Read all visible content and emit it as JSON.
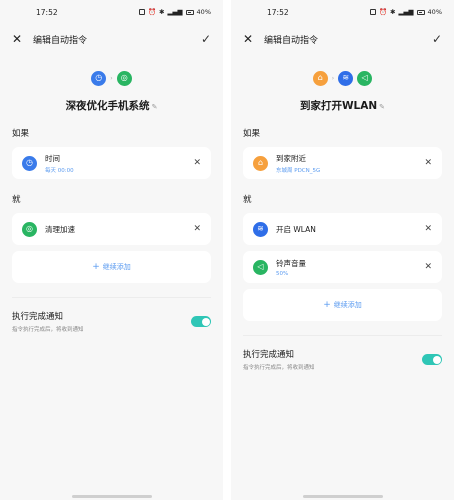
{
  "left": {
    "status": {
      "time": "17:52",
      "battery": "40%"
    },
    "topbar": {
      "title": "编辑自动指令"
    },
    "hero": {
      "name": "深夜优化手机系统"
    },
    "if_section": {
      "title": "如果"
    },
    "if_card": {
      "title": "时间",
      "sub": "每天 00:00"
    },
    "then_section": {
      "title": "就"
    },
    "then_cards": [
      {
        "title": "清理加速",
        "sub": ""
      }
    ],
    "add_label": "继续添加",
    "notify": {
      "title": "执行完成通知",
      "sub": "指令执行完成后，将收到通知",
      "enabled": true
    }
  },
  "right": {
    "status": {
      "time": "17:52",
      "battery": "40%"
    },
    "topbar": {
      "title": "编辑自动指令"
    },
    "hero": {
      "name": "到家打开WLAN"
    },
    "if_section": {
      "title": "如果"
    },
    "if_card": {
      "title": "到家附近",
      "sub": "东城周 PDCN_5G"
    },
    "then_section": {
      "title": "就"
    },
    "then_cards": [
      {
        "title": "开启 WLAN",
        "sub": ""
      },
      {
        "title": "铃声音量",
        "sub": "50%"
      }
    ],
    "add_label": "继续添加",
    "notify": {
      "title": "执行完成通知",
      "sub": "指令执行完成后，将收到通知",
      "enabled": true
    }
  },
  "icons": {
    "clock": "clock-icon",
    "clean": "clean-icon",
    "home": "home-icon",
    "wifi": "wifi-icon",
    "volume": "volume-icon"
  },
  "colors": {
    "blue": "#3a7bea",
    "green": "#29b562",
    "orange": "#f6a03d",
    "teal_toggle": "#2fc6b6",
    "link_blue": "#5b9bf0"
  }
}
